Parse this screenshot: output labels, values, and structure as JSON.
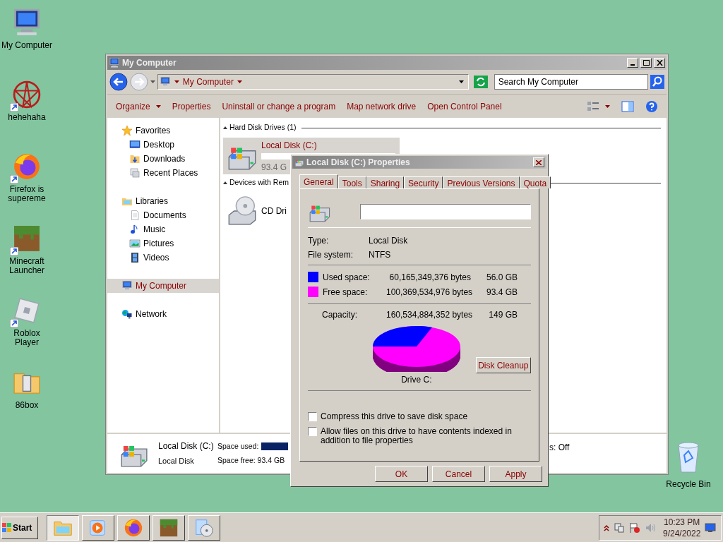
{
  "desktop_icons": [
    {
      "label": "My Computer",
      "kind": "computer",
      "shortcut": false
    },
    {
      "label": "hehehaha",
      "kind": "emblem",
      "shortcut": true
    },
    {
      "label": "Firefox is supereme",
      "kind": "firefox",
      "shortcut": true
    },
    {
      "label": "Minecraft Launcher",
      "kind": "grass",
      "shortcut": true
    },
    {
      "label": "Roblox Player",
      "kind": "roblox",
      "shortcut": true
    },
    {
      "label": "86box",
      "kind": "folder",
      "shortcut": false
    }
  ],
  "recycle_bin": {
    "label": "Recycle Bin"
  },
  "explorer": {
    "title": "My Computer",
    "address": "My Computer",
    "search": {
      "placeholder": "Search My Computer"
    },
    "toolbar": [
      {
        "label": "Organize",
        "dropdown": true
      },
      {
        "label": "Properties",
        "dropdown": false
      },
      {
        "label": "Uninstall or change a program",
        "dropdown": false
      },
      {
        "label": "Map network drive",
        "dropdown": false
      },
      {
        "label": "Open Control Panel",
        "dropdown": false
      }
    ],
    "sidebar": [
      {
        "label": "Favorites",
        "kind": "star",
        "selected": false,
        "children": [
          {
            "label": "Desktop",
            "kind": "desktop",
            "selected": false
          },
          {
            "label": "Downloads",
            "kind": "download",
            "selected": false
          },
          {
            "label": "Recent Places",
            "kind": "recent",
            "selected": false
          }
        ]
      },
      {
        "label": "Libraries",
        "kind": "library",
        "selected": false,
        "children": [
          {
            "label": "Documents",
            "kind": "document",
            "selected": false
          },
          {
            "label": "Music",
            "kind": "music",
            "selected": false
          },
          {
            "label": "Pictures",
            "kind": "pictures",
            "selected": false
          },
          {
            "label": "Videos",
            "kind": "video",
            "selected": false
          }
        ]
      },
      {
        "label": "My Computer",
        "kind": "computer",
        "selected": true
      },
      {
        "label": "Network",
        "kind": "network",
        "selected": false
      }
    ],
    "groups": [
      {
        "heading": "Hard Disk Drives (1)",
        "items": [
          {
            "name": "Local Disk (C:)",
            "detail": "93.4 G",
            "kind": "hdd",
            "selected": true
          }
        ]
      },
      {
        "heading": "Devices with Rem",
        "items": [
          {
            "name": "CD Dri",
            "kind": "cd",
            "selected": false
          }
        ]
      }
    ],
    "details": {
      "name": "Local Disk (C:)",
      "type": "Local Disk",
      "used_label": "Space used:",
      "free_label": "Space free: 93.4 GB",
      "right_text": "s: Off"
    }
  },
  "dialog": {
    "title": "Local Disk (C:) Properties",
    "tabs": [
      {
        "label": "General",
        "selected": true
      },
      {
        "label": "Tools",
        "selected": false
      },
      {
        "label": "Sharing",
        "selected": false
      },
      {
        "label": "Security",
        "selected": false
      },
      {
        "label": "Previous Versions",
        "selected": false
      },
      {
        "label": "Quota",
        "selected": false
      }
    ],
    "info": [
      {
        "label": "Type:",
        "value": "Local Disk"
      },
      {
        "label": "File system:",
        "value": "NTFS"
      }
    ],
    "space": [
      {
        "label": "Used space:",
        "bytes": "60,165,349,376 bytes",
        "size": "56.0 GB",
        "color": "#0000ff"
      },
      {
        "label": "Free space:",
        "bytes": "100,369,534,976 bytes",
        "size": "93.4 GB",
        "color": "#ff00ff"
      }
    ],
    "capacity": {
      "label": "Capacity:",
      "bytes": "160,534,884,352 bytes",
      "size": "149 GB"
    },
    "drive_label": "Drive C:",
    "cleanup": "Disk Cleanup",
    "options": [
      {
        "label": "Compress this drive to save disk space",
        "checked": false
      },
      {
        "label": "Allow files on this drive to have contents indexed in addition to file properties",
        "checked": false
      }
    ],
    "buttons": [
      "OK",
      "Cancel",
      "Apply"
    ]
  },
  "taskbar": {
    "start": "Start",
    "apps": [
      {
        "kind": "explorer",
        "selected": true
      },
      {
        "kind": "media",
        "selected": false
      },
      {
        "kind": "firefox",
        "selected": false
      },
      {
        "kind": "grass",
        "selected": false
      },
      {
        "kind": "disc",
        "selected": false
      }
    ],
    "clock": {
      "time": "10:23 PM",
      "date": "9/24/2022"
    }
  }
}
